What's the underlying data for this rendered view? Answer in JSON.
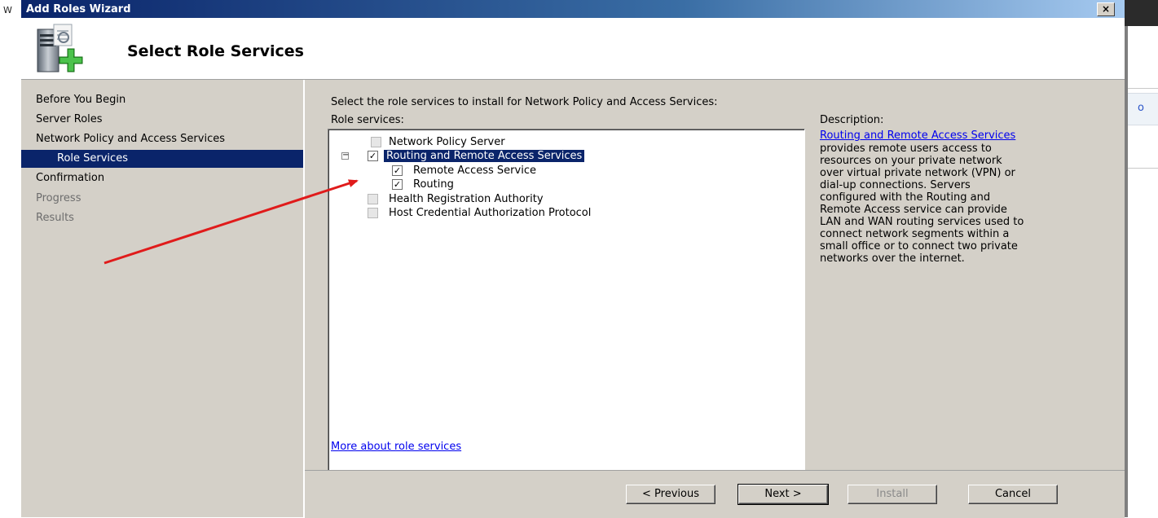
{
  "background": {
    "left_fragment": "W",
    "right_fragment": "o"
  },
  "window": {
    "title": "Add Roles Wizard",
    "close_glyph": "×"
  },
  "header": {
    "title": "Select Role Services",
    "icon": "server-add-icon"
  },
  "nav": {
    "items": [
      {
        "label": "Before You Begin",
        "state": "normal"
      },
      {
        "label": "Server Roles",
        "state": "normal"
      },
      {
        "label": "Network Policy and Access Services",
        "state": "normal"
      },
      {
        "label": "Role Services",
        "state": "selected"
      },
      {
        "label": "Confirmation",
        "state": "normal"
      },
      {
        "label": "Progress",
        "state": "disabled"
      },
      {
        "label": "Results",
        "state": "disabled"
      }
    ]
  },
  "main": {
    "instruction": "Select the role services to install for Network Policy and Access Services:",
    "role_services_label": "Role services:",
    "tree": [
      {
        "label": "Network Policy Server",
        "checked": false,
        "level": 0
      },
      {
        "label": "Routing and Remote Access Services",
        "checked": true,
        "level": 0,
        "expanded": true
      },
      {
        "label": "Remote Access Service",
        "checked": true,
        "level": 1
      },
      {
        "label": "Routing",
        "checked": true,
        "level": 1
      },
      {
        "label": "Health Registration Authority",
        "checked": false,
        "level": 0
      },
      {
        "label": "Host Credential Authorization Protocol",
        "checked": false,
        "level": 0
      }
    ],
    "more_link": "More about role services",
    "description_label": "Description:",
    "description_link": "Routing and Remote Access Services",
    "description_lines": [
      "provides remote users access to",
      "resources on your private network",
      "over virtual private network (VPN) or",
      "dial-up connections. Servers",
      "configured with the Routing and",
      "Remote Access service can provide",
      "LAN and WAN routing services used to",
      "connect network segments within a",
      "small office or to connect two private",
      "networks over the internet."
    ]
  },
  "buttons": {
    "previous": "< Previous",
    "next": "Next >",
    "install": "Install",
    "cancel": "Cancel"
  },
  "colors": {
    "selection": "#0a246a",
    "annotation_arrow": "#e01b1b",
    "link": "#0000ee"
  }
}
